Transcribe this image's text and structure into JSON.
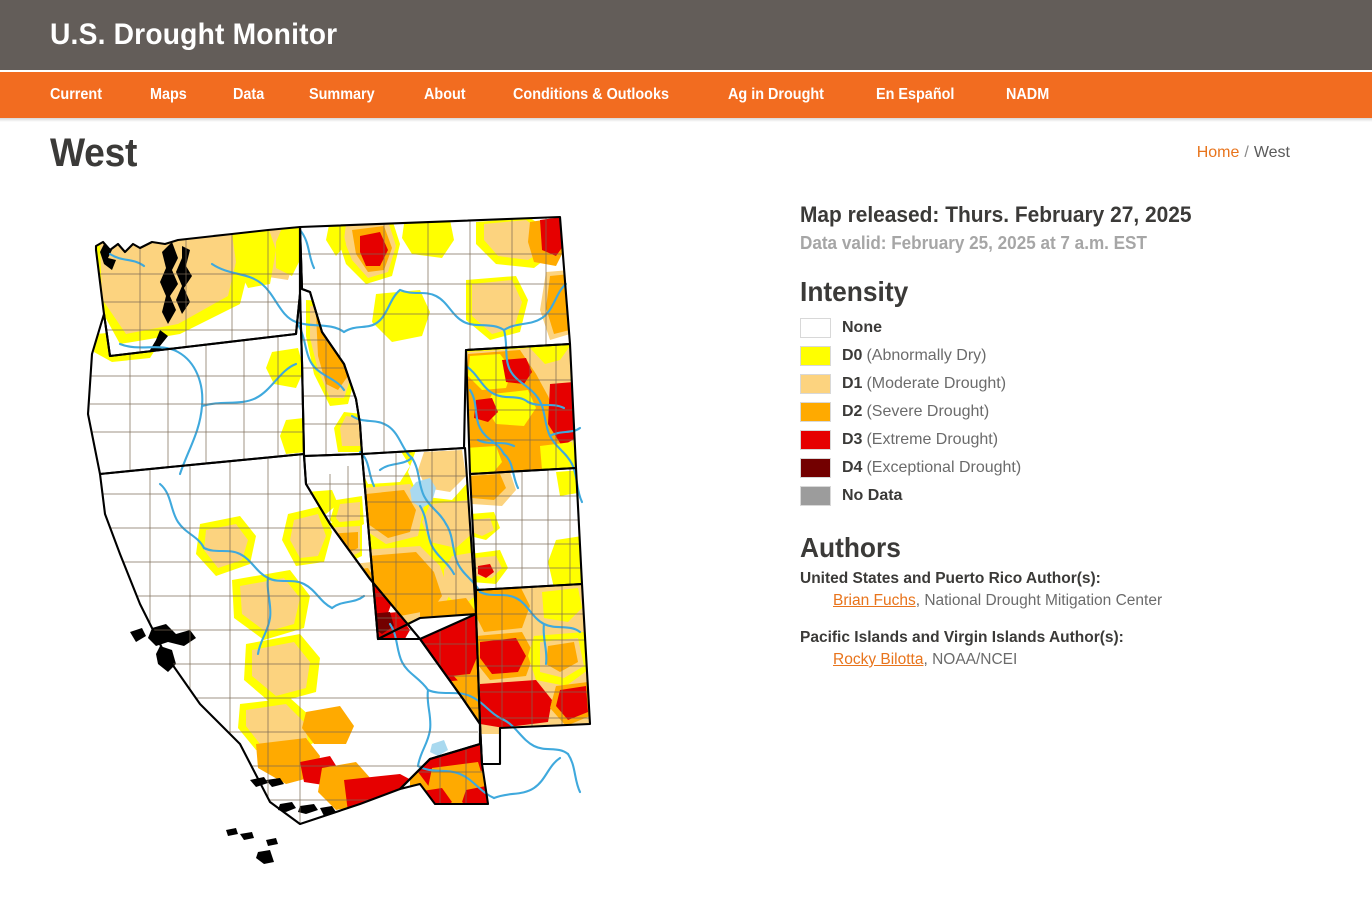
{
  "header": {
    "title": "U.S. Drought Monitor"
  },
  "nav": {
    "items": [
      {
        "label": "Current"
      },
      {
        "label": "Maps"
      },
      {
        "label": "Data"
      },
      {
        "label": "Summary"
      },
      {
        "label": "About"
      },
      {
        "label": "Conditions & Outlooks"
      },
      {
        "label": "Ag in Drought"
      },
      {
        "label": "En Español"
      },
      {
        "label": "NADM"
      }
    ]
  },
  "page": {
    "title": "West"
  },
  "breadcrumb": {
    "home": "Home",
    "separator": "/",
    "current": "West"
  },
  "release": {
    "released": "Map released: Thurs. February 27, 2025",
    "valid": "Data valid: February 25, 2025 at 7 a.m. EST"
  },
  "intensity": {
    "heading": "Intensity",
    "items": [
      {
        "code": "None",
        "desc": "",
        "color": "#ffffff"
      },
      {
        "code": "D0",
        "desc": "(Abnormally Dry)",
        "color": "#ffff00"
      },
      {
        "code": "D1",
        "desc": "(Moderate Drought)",
        "color": "#fcd37f"
      },
      {
        "code": "D2",
        "desc": "(Severe Drought)",
        "color": "#ffaa00"
      },
      {
        "code": "D3",
        "desc": "(Extreme Drought)",
        "color": "#e60000"
      },
      {
        "code": "D4",
        "desc": "(Exceptional Drought)",
        "color": "#730000"
      },
      {
        "code": "No Data",
        "desc": "",
        "color": "#9c9c9c"
      }
    ]
  },
  "authors": {
    "heading": "Authors",
    "groups": [
      {
        "label": "United States and Puerto Rico Author(s):",
        "name": "Brian Fuchs",
        "affiliation": ", National Drought Mitigation Center"
      },
      {
        "label": "Pacific Islands and Virgin Islands Author(s):",
        "name": "Rocky Bilotta",
        "affiliation": ", NOAA/NCEI"
      }
    ]
  },
  "map": {
    "region": "West",
    "colors": {
      "none": "#ffffff",
      "d0": "#ffff00",
      "d1": "#fcd37f",
      "d2": "#ffaa00",
      "d3": "#e60000",
      "d4": "#730000",
      "water": "#a9d9ef",
      "river": "#3fa9dd",
      "county_line": "#7a6a55",
      "state_line": "#000000"
    },
    "states": [
      "WA",
      "OR",
      "CA",
      "ID",
      "NV",
      "UT",
      "AZ",
      "MT",
      "WY",
      "CO",
      "NM"
    ]
  }
}
